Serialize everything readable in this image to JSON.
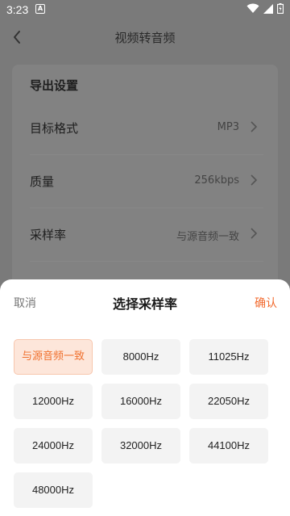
{
  "status": {
    "time": "3:23",
    "notif_glyph": "A"
  },
  "appbar": {
    "title": "视频转音频",
    "back_icon": "back-arrow-icon"
  },
  "export": {
    "heading": "导出设置",
    "rows": [
      {
        "label": "目标格式",
        "value": "MP3"
      },
      {
        "label": "质量",
        "value": "256kbps"
      },
      {
        "label": "采样率",
        "value": "与源音频一致"
      }
    ]
  },
  "sheet": {
    "cancel": "取消",
    "title": "选择采样率",
    "confirm": "确认",
    "options": [
      "与源音频一致",
      "8000Hz",
      "11025Hz",
      "12000Hz",
      "16000Hz",
      "22050Hz",
      "24000Hz",
      "32000Hz",
      "44100Hz",
      "48000Hz"
    ],
    "selected": "与源音频一致"
  },
  "colors": {
    "accent": "#f26a2e",
    "selected_bg": "#fde6da",
    "option_bg": "#f3f3f3"
  }
}
